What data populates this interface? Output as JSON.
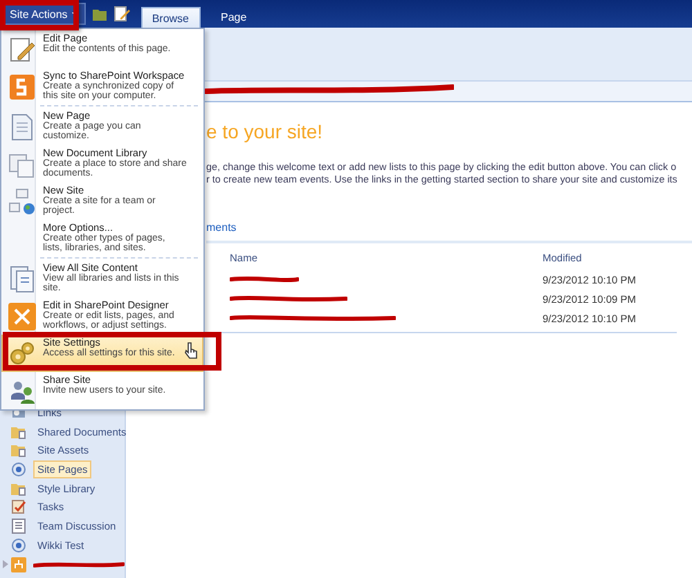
{
  "top_bar": {
    "site_actions": "Site Actions"
  },
  "tabs": [
    {
      "label": "Browse",
      "selected": true
    },
    {
      "label": "Page",
      "selected": false
    }
  ],
  "menu": {
    "sections": [
      [
        {
          "kind": "edit",
          "title": "Edit Page",
          "description": "Edit the contents of this page.",
          "selected": false
        },
        {
          "kind": "workspace",
          "title": "Sync to SharePoint Workspace",
          "description": "Create a synchronized copy of this site on your computer.",
          "selected": false
        }
      ],
      [
        {
          "kind": "page",
          "title": "New Page",
          "description": "Create a page you can customize.",
          "selected": false
        },
        {
          "kind": "library",
          "title": "New Document Library",
          "description": "Create a place to store and share documents.",
          "selected": false
        },
        {
          "kind": "site",
          "title": "New Site",
          "description": "Create a site for a team or project.",
          "selected": false
        },
        {
          "kind": "none",
          "title": "More Options...",
          "description": "Create other types of pages, lists, libraries, and sites.",
          "selected": false
        }
      ],
      [
        {
          "kind": "content",
          "title": "View All Site Content",
          "description": "View all libraries and lists in this site.",
          "selected": false
        },
        {
          "kind": "designer",
          "title": "Edit in SharePoint Designer",
          "description": "Create or edit lists, pages, and workflows, or adjust settings.",
          "selected": false
        },
        {
          "kind": "settings",
          "title": "Site Settings",
          "description": "Access all settings for this site.",
          "selected": true
        },
        {
          "kind": "share",
          "title": "Share Site",
          "description": "Invite new users to your site.",
          "selected": false
        }
      ]
    ]
  },
  "content": {
    "title": "e to your site!",
    "intro_lines": [
      "ge, change this welcome text or add new lists to this page by clicking the edit button above. You can click o",
      "r to create new team events. Use the links in the getting started section to share your site and customize its"
    ],
    "section_link": "ments",
    "table": {
      "columns": [
        "Name",
        "Modified"
      ],
      "rows": [
        {
          "modified": "9/23/2012 10:10 PM"
        },
        {
          "modified": "9/23/2012 10:09 PM"
        },
        {
          "modified": "9/23/2012 10:10 PM"
        }
      ]
    }
  },
  "sidebar": {
    "items": [
      {
        "kind": "links",
        "label": "Links",
        "selected": false
      },
      {
        "kind": "folder",
        "label": "Shared Documents",
        "selected": false
      },
      {
        "kind": "folder",
        "label": "Site Assets",
        "selected": false
      },
      {
        "kind": "page",
        "label": "Site Pages",
        "selected": true
      },
      {
        "kind": "folder",
        "label": "Style Library",
        "selected": false
      },
      {
        "kind": "tasks",
        "label": "Tasks",
        "selected": false
      },
      {
        "kind": "discussion",
        "label": "Team Discussion",
        "selected": false
      },
      {
        "kind": "page",
        "label": "Wikki Test",
        "selected": false
      },
      {
        "kind": "subsite",
        "selected": false
      }
    ]
  }
}
